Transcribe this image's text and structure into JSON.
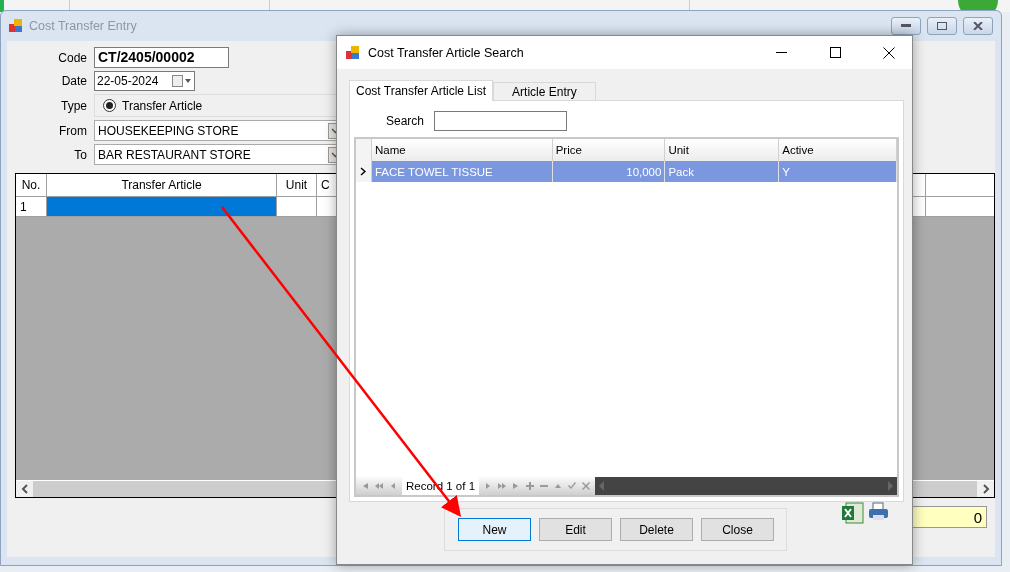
{
  "background_window": {
    "title": "Cost Transfer Entry",
    "form": {
      "code_label": "Code",
      "code": "CT/2405/00002",
      "date_label": "Date",
      "date": "22-05-2024",
      "type_label": "Type",
      "type_options": [
        {
          "label": "Transfer Article",
          "selected": true
        }
      ],
      "from_label": "From",
      "from": "HOUSEKEEPING STORE",
      "to_label": "To",
      "to": "BAR RESTAURANT STORE"
    },
    "grid": {
      "columns": [
        "No.",
        "Transfer Article",
        "Unit",
        "C"
      ],
      "rows": [
        {
          "no": "1",
          "selected": true
        }
      ]
    },
    "total": "0"
  },
  "dialog": {
    "title": "Cost Transfer Article Search",
    "tabs": [
      {
        "label": "Cost Transfer Article List",
        "selected": true
      },
      {
        "label": "Article Entry",
        "selected": false
      }
    ],
    "search": {
      "label": "Search"
    },
    "grid": {
      "columns": [
        "Name",
        "Price",
        "Unit",
        "Active"
      ],
      "rows": [
        {
          "name": "FACE TOWEL TISSUE",
          "price": "10,000",
          "unit": "Pack",
          "active": "Y",
          "selected": true
        }
      ]
    },
    "navigator": {
      "record": "Record 1 of 1"
    },
    "buttons": [
      {
        "label": "New",
        "focused": true
      },
      {
        "label": "Edit",
        "focused": false
      },
      {
        "label": "Delete",
        "focused": false
      },
      {
        "label": "Close",
        "focused": false
      }
    ]
  }
}
